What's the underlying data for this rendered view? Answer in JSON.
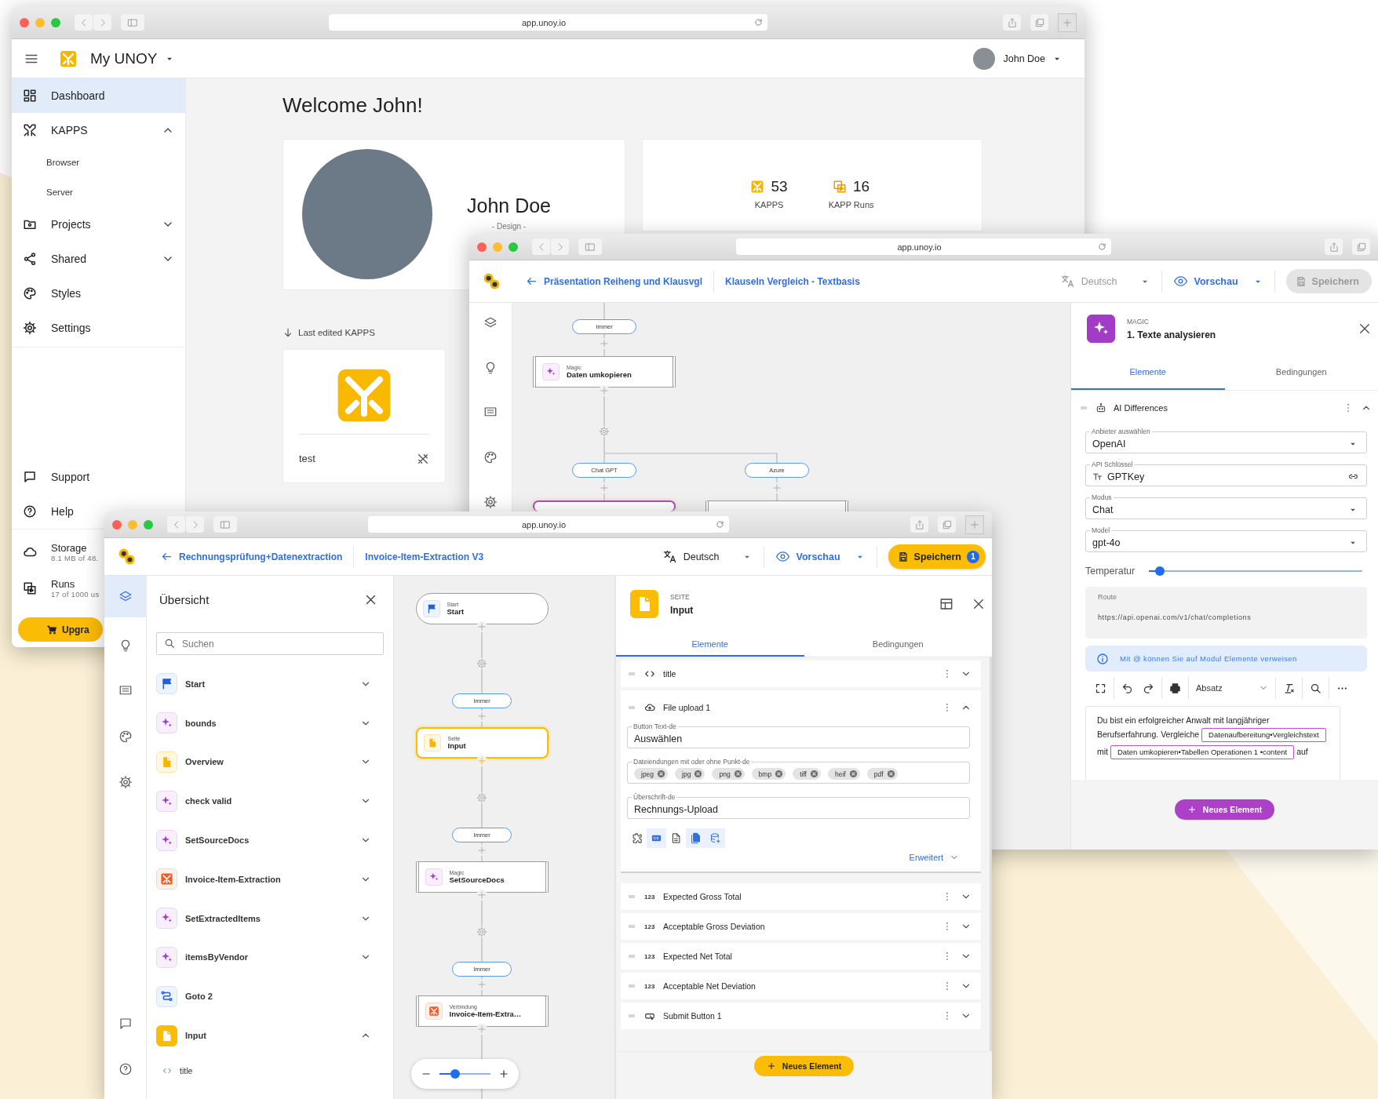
{
  "dashboard_window": {
    "url": "app.unoy.io",
    "app_title": "My UNOY",
    "user_name": "John Doe",
    "nav": [
      {
        "label": "Dashboard",
        "selected": true
      },
      {
        "label": "KAPPS",
        "selected": false,
        "expanded": true,
        "children": [
          {
            "label": "Browser",
            "selected": false
          },
          {
            "label": "Server",
            "selected": false
          }
        ]
      },
      {
        "label": "Projects",
        "selected": false,
        "expanded": false
      },
      {
        "label": "Shared",
        "selected": false,
        "expanded": false
      },
      {
        "label": "Styles",
        "selected": false
      },
      {
        "label": "Settings",
        "selected": false
      }
    ],
    "footer_nav": [
      {
        "label": "Support"
      },
      {
        "label": "Help"
      }
    ],
    "usage": [
      {
        "label": "Storage",
        "detail": "8.1 MB of 48."
      },
      {
        "label": "Runs",
        "detail": "17 of 1000 us"
      }
    ],
    "upgrade_button": "Upgra",
    "welcome": "Welcome John!",
    "profile": {
      "name": "John Doe",
      "role": "- Design -"
    },
    "stats": [
      {
        "value": "53",
        "label": "KAPPS"
      },
      {
        "value": "16",
        "label": "KAPP Runs"
      }
    ],
    "section_title": "Last edited KAPPS",
    "kapps": [
      {
        "name": "test"
      }
    ]
  },
  "editor_back": {
    "url": "app.unoy.io",
    "breadcrumbs": [
      "Präsentation Reiheng und Klausvgl",
      "Klauseln Vergleich - Textbasis"
    ],
    "language": "Deutsch",
    "preview": "Vorschau",
    "save": {
      "label": "Speichern",
      "disabled": true
    },
    "rail": [
      {
        "selected": false
      },
      {
        "selected": false
      },
      {
        "selected": false
      },
      {
        "selected": false
      },
      {
        "selected": false
      }
    ],
    "flow": {
      "condition": "Immer",
      "step": {
        "kind": "magic",
        "type": "Magic",
        "title": "Daten umkopieren",
        "selected": false
      },
      "branches": [
        {
          "condition": "Chat GPT",
          "step": {
            "kind": "magic",
            "selected": true
          }
        },
        {
          "condition": "Azure",
          "step": {
            "kind": "magic",
            "selected": false
          }
        }
      ]
    },
    "panel": {
      "type": "MAGIC",
      "title": "1. Texte analysieren",
      "tabs": [
        {
          "label": "Elemente",
          "selected": true
        },
        {
          "label": "Bedingungen",
          "selected": false
        }
      ],
      "section": {
        "title": "AI Differences",
        "expanded": true
      },
      "fields": [
        {
          "kind": "select",
          "label": "Anbieter auswählen",
          "value": "OpenAI"
        },
        {
          "kind": "text",
          "label": "API Schlüssel",
          "value": "GPTKey"
        },
        {
          "kind": "select",
          "label": "Modus",
          "value": "Chat"
        },
        {
          "kind": "select",
          "label": "Model",
          "value": "gpt-4o"
        }
      ],
      "slider": {
        "label": "Temperatur",
        "level": 0.05
      },
      "route": {
        "label": "Route",
        "value": "https://api.openai.com/v1/chat/completions"
      },
      "info": "Mit @ können Sie auf Modul Elemente verweisen",
      "block_format": "Absatz",
      "editor": [
        {
          "kind": "text",
          "text": "Du bist ein erfolgreicher Anwalt mit langjähriger Berufserfahrung. Vergleiche"
        },
        {
          "kind": "chip",
          "text": "Datenaufbereitung•Vergleichstext"
        },
        {
          "kind": "text",
          "text": "mit"
        },
        {
          "kind": "chip",
          "text": "Daten umkopieren•Tabellen Operationen 1 •content"
        },
        {
          "kind": "text",
          "text": "auf"
        }
      ],
      "add_button": "Neues Element"
    }
  },
  "editor_front": {
    "url": "app.unoy.io",
    "breadcrumbs": [
      "Rechnungsprüfung+Datenextraction",
      "Invoice-Item-Extraction V3"
    ],
    "language": "Deutsch",
    "preview": "Vorschau",
    "save": {
      "label": "Speichern",
      "disabled": false,
      "badge": "1"
    },
    "rail": [
      {
        "selected": true
      },
      {
        "selected": false
      },
      {
        "selected": false
      },
      {
        "selected": false
      },
      {
        "selected": false
      }
    ],
    "overview": {
      "title": "Übersicht",
      "search_placeholder": "Suchen",
      "items": [
        {
          "kind": "start",
          "label": "Start",
          "selected": false,
          "expanded": false
        },
        {
          "kind": "magic",
          "label": "bounds",
          "selected": false,
          "expanded": false
        },
        {
          "kind": "page",
          "label": "Overview",
          "selected": false,
          "expanded": false
        },
        {
          "kind": "magic",
          "label": "check valid",
          "selected": false,
          "expanded": false
        },
        {
          "kind": "magic",
          "label": "SetSourceDocs",
          "selected": false,
          "expanded": false
        },
        {
          "kind": "connection",
          "label": "Invoice-Item-Extraction",
          "selected": false,
          "expanded": false
        },
        {
          "kind": "magic",
          "label": "SetExtractedItems",
          "selected": false,
          "expanded": false
        },
        {
          "kind": "magic",
          "label": "itemsByVendor",
          "selected": false,
          "expanded": false
        },
        {
          "kind": "goto",
          "label": "Goto 2",
          "selected": false
        },
        {
          "kind": "page",
          "label": "Input",
          "selected": true,
          "expanded": true,
          "children": [
            {
              "label": "title"
            }
          ]
        }
      ]
    },
    "flow": {
      "steps": [
        {
          "kind": "start",
          "type": "Start",
          "title": "Start",
          "selected": false,
          "condition": "Immer"
        },
        {
          "kind": "page",
          "type": "Seite",
          "title": "Input",
          "selected": true,
          "condition": "Immer"
        },
        {
          "kind": "magic",
          "type": "Magic",
          "title": "SetSourceDocs",
          "selected": false,
          "condition": "Immer"
        },
        {
          "kind": "connection",
          "type": "Verbindung",
          "title": "Invoice-Item-Extra…",
          "selected": false
        }
      ],
      "zoom": {
        "level": 0.3
      }
    },
    "panel": {
      "type": "SEITE",
      "title": "Input",
      "tabs": [
        {
          "label": "Elemente",
          "selected": true
        },
        {
          "label": "Bedingungen",
          "selected": false
        }
      ],
      "elements": [
        {
          "kind": "code",
          "label": "title",
          "expanded": false
        },
        {
          "kind": "upload",
          "label": "File upload 1",
          "expanded": true,
          "fields": [
            {
              "kind": "text",
              "label": "Button Text-de",
              "value": "Auswählen"
            },
            {
              "kind": "chips",
              "label": "Dateiendungen mit oder ohne Punkt-de",
              "chips": [
                "jpeg",
                "jpg",
                "png",
                "bmp",
                "tiff",
                "heif",
                "pdf"
              ]
            },
            {
              "kind": "text",
              "label": "Überschrift-de",
              "value": "Rechnungs-Upload"
            }
          ],
          "options": [
            {
              "on": false
            },
            {
              "on": true
            },
            {
              "on": false
            },
            {
              "on": true
            },
            {
              "on": true
            }
          ],
          "advanced": "Erweitert"
        },
        {
          "kind": "number",
          "type_label": "123",
          "label": "Expected Gross Total",
          "expanded": false
        },
        {
          "kind": "number",
          "type_label": "123",
          "label": "Acceptable Gross Deviation",
          "expanded": false
        },
        {
          "kind": "number",
          "type_label": "123",
          "label": "Expected Net Total",
          "expanded": false
        },
        {
          "kind": "number",
          "type_label": "123",
          "label": "Acceptable Net Deviation",
          "expanded": false
        },
        {
          "kind": "button",
          "label": "Submit Button 1",
          "expanded": false
        }
      ],
      "add_button": "Neues Element"
    }
  }
}
